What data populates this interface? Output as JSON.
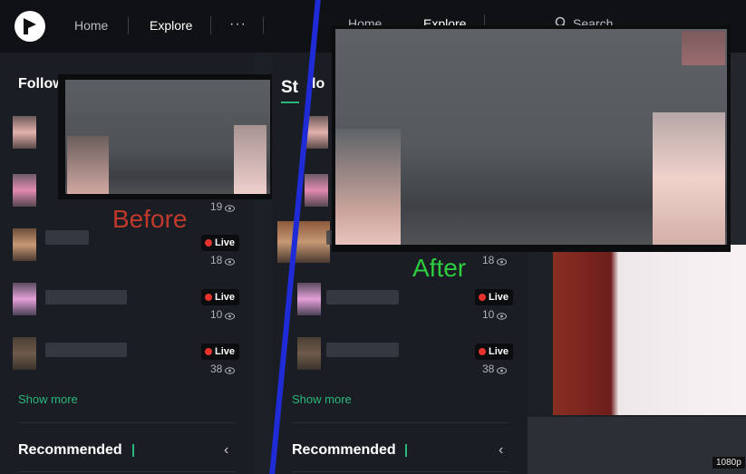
{
  "nav": {
    "home": "Home",
    "explore": "Explore",
    "more": "···",
    "search": "Search"
  },
  "sidebar": {
    "title_left": "Follow",
    "title_right": "St",
    "title_right_tail": "lo",
    "rows": [
      {
        "live": "",
        "viewers": "19"
      },
      {
        "live": "Live",
        "viewers": "18"
      },
      {
        "live": "Live",
        "viewers": "10"
      },
      {
        "live": "Live",
        "viewers": "38"
      }
    ],
    "show_more": "Show more",
    "recommended": "Recommended"
  },
  "captions": {
    "before": "Before",
    "after": "After"
  },
  "colors": {
    "before": "#c0392b",
    "after": "#2ecc40",
    "divider": "#1f2bd6",
    "accent": "#2bb67a"
  },
  "player": {
    "quality": "1080p"
  }
}
